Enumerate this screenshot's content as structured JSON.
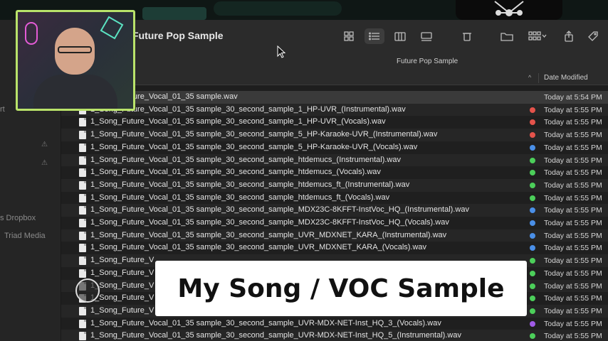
{
  "window": {
    "title": "Future Pop Sample"
  },
  "pathbar": {
    "label": "Future Pop Sample"
  },
  "columns": {
    "date_modified": "Date Modified",
    "sort_indicator": "^"
  },
  "sidebar": {
    "items": [
      {
        "label": "rt"
      },
      {
        "label": "s Dropbox"
      },
      {
        "label": "Triad Media"
      }
    ],
    "warning_icon": "⚠"
  },
  "files": [
    {
      "name": "1_Song_Future_Vocal_01_35 sample.wav",
      "date": "Today at 5:54 PM",
      "tag": ""
    },
    {
      "name": "1_Song_Future_Vocal_01_35 sample_30_second_sample_1_HP-UVR_(Instrumental).wav",
      "date": "Today at 5:55 PM",
      "tag": "#e5534b"
    },
    {
      "name": "1_Song_Future_Vocal_01_35 sample_30_second_sample_1_HP-UVR_(Vocals).wav",
      "date": "Today at 5:55 PM",
      "tag": "#e5534b"
    },
    {
      "name": "1_Song_Future_Vocal_01_35 sample_30_second_sample_5_HP-Karaoke-UVR_(Instrumental).wav",
      "date": "Today at 5:55 PM",
      "tag": "#e5534b"
    },
    {
      "name": "1_Song_Future_Vocal_01_35 sample_30_second_sample_5_HP-Karaoke-UVR_(Vocals).wav",
      "date": "Today at 5:55 PM",
      "tag": "#4a8fe7"
    },
    {
      "name": "1_Song_Future_Vocal_01_35 sample_30_second_sample_htdemucs_(Instrumental).wav",
      "date": "Today at 5:55 PM",
      "tag": "#4ccf5a"
    },
    {
      "name": "1_Song_Future_Vocal_01_35 sample_30_second_sample_htdemucs_(Vocals).wav",
      "date": "Today at 5:55 PM",
      "tag": "#4ccf5a"
    },
    {
      "name": "1_Song_Future_Vocal_01_35 sample_30_second_sample_htdemucs_ft_(Instrumental).wav",
      "date": "Today at 5:55 PM",
      "tag": "#4ccf5a"
    },
    {
      "name": "1_Song_Future_Vocal_01_35 sample_30_second_sample_htdemucs_ft_(Vocals).wav",
      "date": "Today at 5:55 PM",
      "tag": "#4ccf5a"
    },
    {
      "name": "1_Song_Future_Vocal_01_35 sample_30_second_sample_MDX23C-8KFFT-InstVoc_HQ_(Instrumental).wav",
      "date": "Today at 5:55 PM",
      "tag": "#4a8fe7"
    },
    {
      "name": "1_Song_Future_Vocal_01_35 sample_30_second_sample_MDX23C-8KFFT-InstVoc_HQ_(Vocals).wav",
      "date": "Today at 5:55 PM",
      "tag": "#4a8fe7"
    },
    {
      "name": "1_Song_Future_Vocal_01_35 sample_30_second_sample_UVR_MDXNET_KARA_(Instrumental).wav",
      "date": "Today at 5:55 PM",
      "tag": "#4a8fe7"
    },
    {
      "name": "1_Song_Future_Vocal_01_35 sample_30_second_sample_UVR_MDXNET_KARA_(Vocals).wav",
      "date": "Today at 5:55 PM",
      "tag": "#4a8fe7"
    },
    {
      "name": "1_Song_Future_V",
      "date": "Today at 5:55 PM",
      "tag": "#4ccf5a"
    },
    {
      "name": "1_Song_Future_V",
      "date": "Today at 5:55 PM",
      "tag": "#4ccf5a"
    },
    {
      "name": "1_Song_Future_V",
      "date": "Today at 5:55 PM",
      "tag": "#4ccf5a"
    },
    {
      "name": "1_Song_Future_V",
      "date": "Today at 5:55 PM",
      "tag": "#4ccf5a"
    },
    {
      "name": "1_Song_Future_V",
      "date": "Today at 5:55 PM",
      "tag": "#4ccf5a"
    },
    {
      "name": "1_Song_Future_Vocal_01_35 sample_30_second_sample_UVR-MDX-NET-Inst_HQ_3_(Vocals).wav",
      "date": "Today at 5:55 PM",
      "tag": "#a05be6"
    },
    {
      "name": "1_Song_Future_Vocal_01_35 sample_30_second_sample_UVR-MDX-NET-Inst_HQ_5_(Instrumental).wav",
      "date": "Today at 5:55 PM",
      "tag": "#4ccf5a"
    }
  ],
  "caption": {
    "text": "My Song / VOC Sample"
  }
}
